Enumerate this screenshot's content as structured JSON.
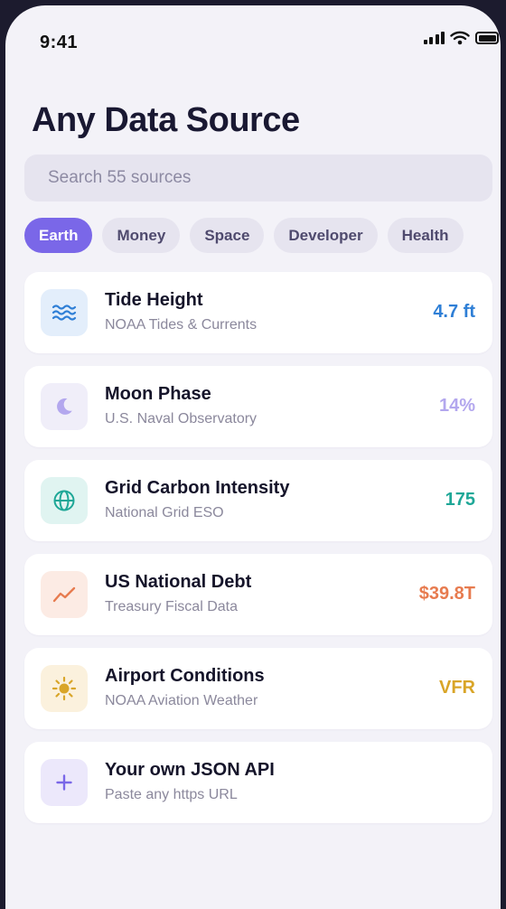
{
  "status_bar": {
    "time": "9:41"
  },
  "page": {
    "title": "Any Data Source"
  },
  "search": {
    "placeholder": "Search 55 sources",
    "value": ""
  },
  "categories": [
    {
      "label": "Earth",
      "active": true
    },
    {
      "label": "Money",
      "active": false
    },
    {
      "label": "Space",
      "active": false
    },
    {
      "label": "Developer",
      "active": false
    },
    {
      "label": "Health",
      "active": false
    }
  ],
  "sources": [
    {
      "icon": "waves-icon",
      "title": "Tide Height",
      "subtitle": "NOAA Tides & Currents",
      "value": "4.7 ft",
      "color": "#2f7fd6",
      "icon_bg": "#e3eefb"
    },
    {
      "icon": "moon-icon",
      "title": "Moon Phase",
      "subtitle": "U.S. Naval Observatory",
      "value": "14%",
      "color": "#b3a7ee",
      "icon_bg": "#f0eef9"
    },
    {
      "icon": "globe-icon",
      "title": "Grid Carbon Intensity",
      "subtitle": "National Grid ESO",
      "value": "175",
      "color": "#1ea797",
      "icon_bg": "#e0f4f1"
    },
    {
      "icon": "trend-line-icon",
      "title": "US National Debt",
      "subtitle": "Treasury Fiscal Data",
      "value": "$39.8T",
      "color": "#e77b4f",
      "icon_bg": "#fcebe4"
    },
    {
      "icon": "sun-icon",
      "title": "Airport Conditions",
      "subtitle": "NOAA Aviation Weather",
      "value": "VFR",
      "color": "#d9a528",
      "icon_bg": "#fbf1dd"
    },
    {
      "icon": "plus-icon",
      "title": "Your own JSON API",
      "subtitle": "Paste any https URL",
      "value": "",
      "color": "#7a67e8",
      "icon_bg": "#ece8fb"
    }
  ],
  "theme": {
    "accent": "#7a67e8",
    "background": "#f3f2f8",
    "chip_bg": "#e6e4ef"
  }
}
